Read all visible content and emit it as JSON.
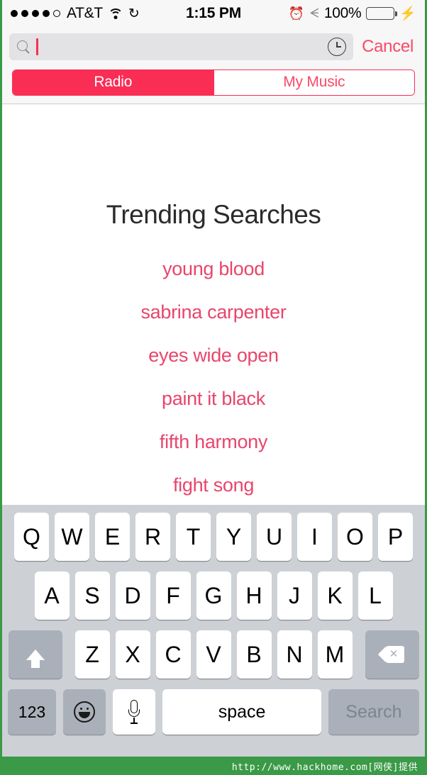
{
  "status_bar": {
    "signal_dots_filled": 4,
    "signal_dots_total": 5,
    "carrier": "AT&T",
    "wifi_icon": "wifi-icon",
    "sync_icon": "sync-icon",
    "time": "1:15 PM",
    "alarm_icon": "alarm-icon",
    "bluetooth_icon": "bluetooth-icon",
    "battery_percent": "100%",
    "battery_icon": "battery-icon",
    "charging_icon": "lightning-bolt-icon"
  },
  "search": {
    "magnifier_icon": "search-icon",
    "value": "",
    "placeholder": "",
    "recents_icon": "clock-icon",
    "cancel_label": "Cancel"
  },
  "segmented_control": {
    "options": [
      {
        "label": "Radio",
        "selected": true
      },
      {
        "label": "My Music",
        "selected": false
      }
    ]
  },
  "main": {
    "title": "Trending Searches",
    "trending": [
      "young blood",
      "sabrina carpenter",
      "eyes wide open",
      "paint it black",
      "fifth harmony",
      "fight song"
    ]
  },
  "keyboard": {
    "row1": [
      "Q",
      "W",
      "E",
      "R",
      "T",
      "Y",
      "U",
      "I",
      "O",
      "P"
    ],
    "row2": [
      "A",
      "S",
      "D",
      "F",
      "G",
      "H",
      "J",
      "K",
      "L"
    ],
    "row3": [
      "Z",
      "X",
      "C",
      "V",
      "B",
      "N",
      "M"
    ],
    "shift_icon": "shift-icon",
    "delete_icon": "backspace-icon",
    "numbers_label": "123",
    "emoji_icon": "emoji-icon",
    "dictation_icon": "microphone-icon",
    "space_label": "space",
    "return_label": "Search"
  },
  "watermark": {
    "text": "http://www.hackhome.com[网侠]提供"
  },
  "colors": {
    "accent": "#fa2d55",
    "trending_text": "#e8456b",
    "cancel": "#fa4968",
    "battery_green": "#4cd764",
    "keyboard_bg": "#cdd1d6",
    "key_dark": "#a9b0b9",
    "watermark_bg": "#3a9a47"
  }
}
